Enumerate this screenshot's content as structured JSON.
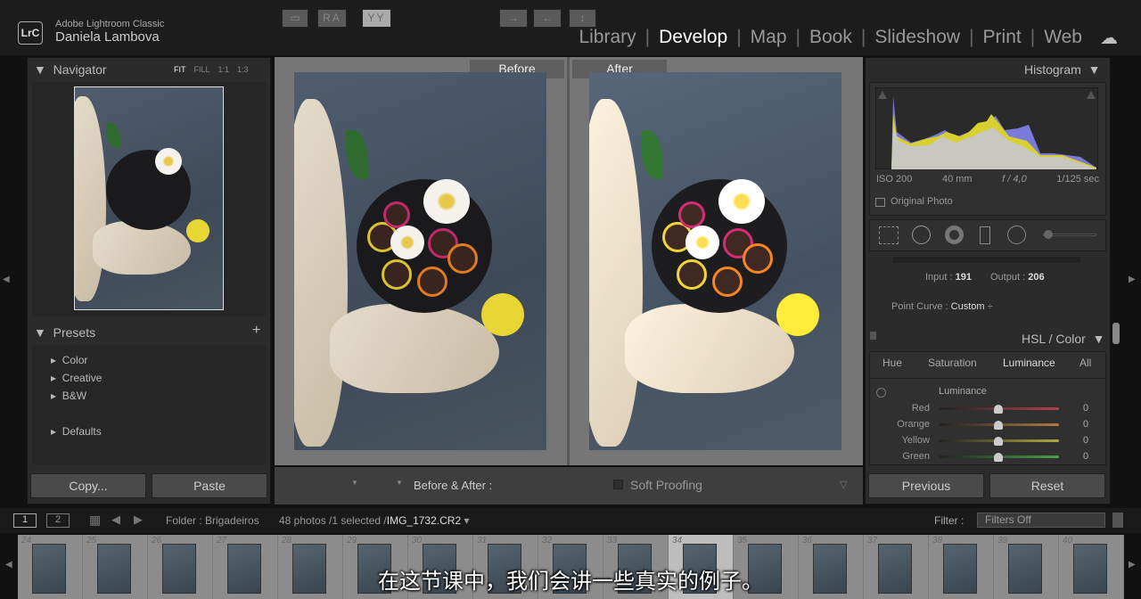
{
  "header": {
    "logo": "LrC",
    "app_name": "Adobe Lightroom Classic",
    "user": "Daniela Lambova",
    "modules": [
      "Library",
      "Develop",
      "Map",
      "Book",
      "Slideshow",
      "Print",
      "Web"
    ],
    "active_module": "Develop"
  },
  "left": {
    "navigator": {
      "title": "Navigator",
      "zoom": [
        "FIT",
        "FILL",
        "1:1",
        "1:3"
      ]
    },
    "presets": {
      "title": "Presets",
      "add": "+",
      "items": [
        "Color",
        "Creative",
        "B&W",
        "Defaults"
      ]
    },
    "copy": "Copy...",
    "paste": "Paste"
  },
  "center": {
    "before": "Before",
    "after": "After"
  },
  "toolbar": {
    "ra": "RA",
    "yy": "YY",
    "before_after_label": "Before & After :",
    "soft_proofing": "Soft Proofing"
  },
  "right": {
    "histogram": {
      "title": "Histogram",
      "iso": "ISO 200",
      "focal": "40 mm",
      "aperture": "f / 4,0",
      "shutter": "1/125 sec",
      "original_photo": "Original Photo"
    },
    "curve": {
      "input_label": "Input :",
      "input": "191",
      "output_label": "Output :",
      "output": "206",
      "point_curve_label": "Point Curve :",
      "point_curve": "Custom"
    },
    "hsl": {
      "title": "HSL / Color",
      "tabs": [
        "Hue",
        "Saturation",
        "Luminance",
        "All"
      ],
      "active_tab": "Luminance",
      "section": "Luminance",
      "sliders": [
        {
          "label": "Red",
          "value": "0",
          "color": "#b0404a"
        },
        {
          "label": "Orange",
          "value": "0",
          "color": "#b07a40"
        },
        {
          "label": "Yellow",
          "value": "0",
          "color": "#b0a840"
        },
        {
          "label": "Green",
          "value": "0",
          "color": "#4aa04a"
        }
      ]
    },
    "previous": "Previous",
    "reset": "Reset"
  },
  "filmstrip": {
    "pages": [
      "1",
      "2"
    ],
    "folder": "Folder : Brigadeiros",
    "count": "48 photos /1 selected /",
    "file": "IMG_1732.CR2",
    "filter_label": "Filter :",
    "filter": "Filters Off",
    "numbers": [
      "24",
      "25",
      "26",
      "27",
      "28",
      "29",
      "30",
      "31",
      "32",
      "33",
      "34",
      "35",
      "36",
      "37",
      "38",
      "39",
      "40"
    ],
    "selected": "34"
  },
  "subtitle": "在这节课中，我们会讲一些真实的例子。"
}
